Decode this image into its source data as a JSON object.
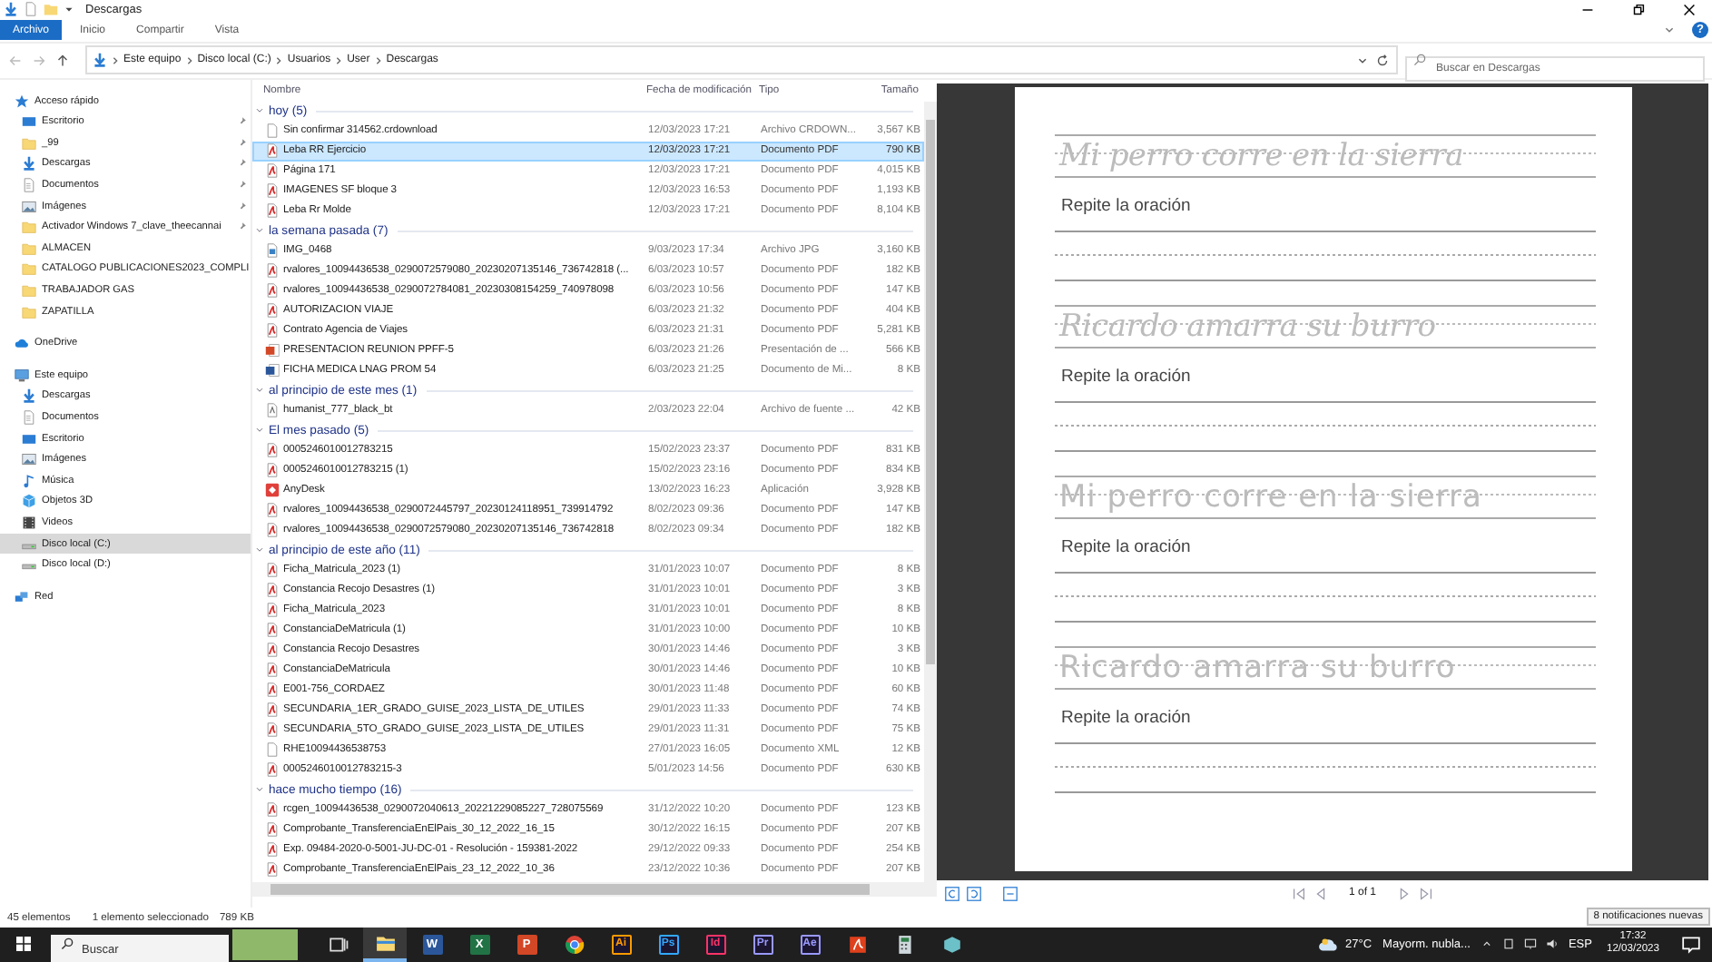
{
  "window": {
    "title": "Descargas",
    "help": "?"
  },
  "ribbon_tabs": [
    {
      "label": "Archivo",
      "selected": true
    },
    {
      "label": "Inicio",
      "selected": false
    },
    {
      "label": "Compartir",
      "selected": false
    },
    {
      "label": "Vista",
      "selected": false
    }
  ],
  "breadcrumb": [
    "Este equipo",
    "Disco local (C:)",
    "Usuarios",
    "User",
    "Descargas"
  ],
  "search": {
    "placeholder": "Buscar en Descargas"
  },
  "nav_pane": [
    {
      "label": "Acceso rápido",
      "kind": "star",
      "selected": false,
      "children": [
        {
          "label": "Escritorio",
          "kind": "desktop",
          "pinned": true,
          "selected": false
        },
        {
          "label": "_99",
          "kind": "folder",
          "pinned": true,
          "selected": false
        },
        {
          "label": "Descargas",
          "kind": "download",
          "pinned": true,
          "selected": false
        },
        {
          "label": "Documentos",
          "kind": "document",
          "pinned": true,
          "selected": false
        },
        {
          "label": "Imágenes",
          "kind": "pictures",
          "pinned": true,
          "selected": false
        },
        {
          "label": "Activador Windows 7_clave_theecannai",
          "kind": "folder",
          "pinned": true,
          "selected": false
        },
        {
          "label": "ALMACEN",
          "kind": "folder",
          "pinned": false,
          "selected": false
        },
        {
          "label": "CATALOGO PUBLICACIONES2023_COMPLI",
          "kind": "folder",
          "pinned": false,
          "selected": false
        },
        {
          "label": "TRABAJADOR GAS",
          "kind": "folder",
          "pinned": false,
          "selected": false
        },
        {
          "label": "ZAPATILLA",
          "kind": "folder",
          "pinned": false,
          "selected": false
        }
      ]
    },
    {
      "label": "OneDrive",
      "kind": "cloud",
      "selected": false
    },
    {
      "label": "Este equipo",
      "kind": "computer",
      "selected": false,
      "children": [
        {
          "label": "Descargas",
          "kind": "download",
          "selected": false
        },
        {
          "label": "Documentos",
          "kind": "document",
          "selected": false
        },
        {
          "label": "Escritorio",
          "kind": "desktop",
          "selected": false
        },
        {
          "label": "Imágenes",
          "kind": "pictures",
          "selected": false
        },
        {
          "label": "Música",
          "kind": "music",
          "selected": false
        },
        {
          "label": "Objetos 3D",
          "kind": "cube",
          "selected": false
        },
        {
          "label": "Videos",
          "kind": "video",
          "selected": false
        },
        {
          "label": "Disco local (C:)",
          "kind": "drive",
          "selected": true
        },
        {
          "label": "Disco local (D:)",
          "kind": "drive",
          "selected": false
        }
      ]
    },
    {
      "label": "Red",
      "kind": "network",
      "selected": false
    }
  ],
  "file_list": {
    "columns": [
      "Nombre",
      "Fecha de modificación",
      "Tipo",
      "Tamaño"
    ],
    "groups": [
      {
        "title": "hoy (5)",
        "files": [
          {
            "name": "Sin confirmar 314562.crdownload",
            "date": "12/03/2023 17:21",
            "type": "Archivo CRDOWN...",
            "size": "3,567 KB",
            "kind": "blank",
            "selected": false
          },
          {
            "name": "Leba RR Ejercicio",
            "date": "12/03/2023 17:21",
            "type": "Documento PDF",
            "size": "790 KB",
            "kind": "pdf",
            "selected": true
          },
          {
            "name": "Página 171",
            "date": "12/03/2023 17:21",
            "type": "Documento PDF",
            "size": "4,015 KB",
            "kind": "pdf",
            "selected": false
          },
          {
            "name": "IMAGENES SF bloque 3",
            "date": "12/03/2023 16:53",
            "type": "Documento PDF",
            "size": "1,193 KB",
            "kind": "pdf",
            "selected": false
          },
          {
            "name": "Leba Rr Molde",
            "date": "12/03/2023 17:21",
            "type": "Documento PDF",
            "size": "8,104 KB",
            "kind": "pdf",
            "selected": false
          }
        ]
      },
      {
        "title": "la semana pasada (7)",
        "files": [
          {
            "name": "IMG_0468",
            "date": "9/03/2023 17:34",
            "type": "Archivo JPG",
            "size": "3,160 KB",
            "kind": "image",
            "selected": false
          },
          {
            "name": "rvalores_10094436538_0290072579080_20230207135146_736742818 (...",
            "date": "6/03/2023 10:57",
            "type": "Documento PDF",
            "size": "182 KB",
            "kind": "pdf",
            "selected": false
          },
          {
            "name": "rvalores_10094436538_0290072784081_20230308154259_740978098",
            "date": "6/03/2023 10:56",
            "type": "Documento PDF",
            "size": "147 KB",
            "kind": "pdf",
            "selected": false
          },
          {
            "name": "AUTORIZACION VIAJE",
            "date": "6/03/2023 21:32",
            "type": "Documento PDF",
            "size": "404 KB",
            "kind": "pdf",
            "selected": false
          },
          {
            "name": "Contrato Agencia de Viajes",
            "date": "6/03/2023 21:31",
            "type": "Documento PDF",
            "size": "5,281 KB",
            "kind": "pdf",
            "selected": false
          },
          {
            "name": "PRESENTACION REUNION PPFF-5",
            "date": "6/03/2023 21:26",
            "type": "Presentación de ...",
            "size": "566 KB",
            "kind": "slides",
            "selected": false
          },
          {
            "name": "FICHA MEDICA LNAG PROM 54",
            "date": "6/03/2023 21:25",
            "type": "Documento de Mi...",
            "size": "8 KB",
            "kind": "word",
            "selected": false
          }
        ]
      },
      {
        "title": "al principio de este mes (1)",
        "files": [
          {
            "name": "humanist_777_black_bt",
            "date": "2/03/2023 22:04",
            "type": "Archivo de fuente ...",
            "size": "42 KB",
            "kind": "font",
            "selected": false
          }
        ]
      },
      {
        "title": "El mes pasado (5)",
        "files": [
          {
            "name": "0005246010012783215",
            "date": "15/02/2023 23:37",
            "type": "Documento PDF",
            "size": "831 KB",
            "kind": "pdf",
            "selected": false
          },
          {
            "name": "0005246010012783215 (1)",
            "date": "15/02/2023 23:16",
            "type": "Documento PDF",
            "size": "834 KB",
            "kind": "pdf",
            "selected": false
          },
          {
            "name": "AnyDesk",
            "date": "13/02/2023 16:23",
            "type": "Aplicación",
            "size": "3,928 KB",
            "kind": "app",
            "selected": false
          },
          {
            "name": "rvalores_10094436538_0290072445797_20230124118951_739914792",
            "date": "8/02/2023 09:36",
            "type": "Documento PDF",
            "size": "147 KB",
            "kind": "pdf",
            "selected": false
          },
          {
            "name": "rvalores_10094436538_0290072579080_20230207135146_736742818",
            "date": "8/02/2023 09:34",
            "type": "Documento PDF",
            "size": "182 KB",
            "kind": "pdf",
            "selected": false
          }
        ]
      },
      {
        "title": "al principio de este año (11)",
        "files": [
          {
            "name": "Ficha_Matricula_2023 (1)",
            "date": "31/01/2023 10:07",
            "type": "Documento PDF",
            "size": "8 KB",
            "kind": "pdf",
            "selected": false
          },
          {
            "name": "Constancia Recojo Desastres (1)",
            "date": "31/01/2023 10:01",
            "type": "Documento PDF",
            "size": "3 KB",
            "kind": "pdf",
            "selected": false
          },
          {
            "name": "Ficha_Matricula_2023",
            "date": "31/01/2023 10:01",
            "type": "Documento PDF",
            "size": "8 KB",
            "kind": "pdf",
            "selected": false
          },
          {
            "name": "ConstanciaDeMatricula (1)",
            "date": "31/01/2023 10:00",
            "type": "Documento PDF",
            "size": "10 KB",
            "kind": "pdf",
            "selected": false
          },
          {
            "name": "Constancia Recojo Desastres",
            "date": "30/01/2023 14:46",
            "type": "Documento PDF",
            "size": "3 KB",
            "kind": "pdf",
            "selected": false
          },
          {
            "name": "ConstanciaDeMatricula",
            "date": "30/01/2023 14:46",
            "type": "Documento PDF",
            "size": "10 KB",
            "kind": "pdf",
            "selected": false
          },
          {
            "name": "E001-756_CORDAEZ",
            "date": "30/01/2023 11:48",
            "type": "Documento PDF",
            "size": "60 KB",
            "kind": "pdf",
            "selected": false
          },
          {
            "name": "SECUNDARIA_1ER_GRADO_GUISE_2023_LISTA_DE_UTILES",
            "date": "29/01/2023 11:33",
            "type": "Documento PDF",
            "size": "74 KB",
            "kind": "pdf",
            "selected": false
          },
          {
            "name": "SECUNDARIA_5TO_GRADO_GUISE_2023_LISTA_DE_UTILES",
            "date": "29/01/2023 11:31",
            "type": "Documento PDF",
            "size": "75 KB",
            "kind": "pdf",
            "selected": false
          },
          {
            "name": "RHE10094436538753",
            "date": "27/01/2023 16:05",
            "type": "Documento XML",
            "size": "12 KB",
            "kind": "blank",
            "selected": false
          },
          {
            "name": "0005246010012783215-3",
            "date": "5/01/2023 14:56",
            "type": "Documento PDF",
            "size": "630 KB",
            "kind": "pdf",
            "selected": false
          }
        ]
      },
      {
        "title": "hace mucho tiempo (16)",
        "files": [
          {
            "name": "rcgen_10094436538_0290072040613_20221229085227_728075569",
            "date": "31/12/2022 10:20",
            "type": "Documento PDF",
            "size": "123 KB",
            "kind": "pdf",
            "selected": false
          },
          {
            "name": "Comprobante_TransferenciaEnElPais_30_12_2022_16_15",
            "date": "30/12/2022 16:15",
            "type": "Documento PDF",
            "size": "207 KB",
            "kind": "pdf",
            "selected": false
          },
          {
            "name": "Exp. 09484-2020-0-5001-JU-DC-01 - Resolución - 159381-2022",
            "date": "29/12/2022 09:33",
            "type": "Documento PDF",
            "size": "254 KB",
            "kind": "pdf",
            "selected": false
          },
          {
            "name": "Comprobante_TransferenciaEnElPais_23_12_2022_10_36",
            "date": "23/12/2022 10:36",
            "type": "Documento PDF",
            "size": "207 KB",
            "kind": "pdf",
            "selected": false
          }
        ]
      }
    ]
  },
  "preview": {
    "sections": [
      {
        "kind": "cursive",
        "trace": "Mi perro corre en la sierra",
        "prompt": "Repite la oración"
      },
      {
        "kind": "cursive",
        "trace": "Ricardo amarra su burro",
        "prompt": "Repite la oración"
      },
      {
        "kind": "print",
        "trace": "Mi perro corre en la sierra",
        "prompt": "Repite la oración"
      },
      {
        "kind": "print",
        "trace": "Ricardo amarra su burro",
        "prompt": "Repite la oración"
      }
    ],
    "page_indicator": "1 of 1"
  },
  "status_bar": {
    "count": "45 elementos",
    "selection": "1 elemento seleccionado",
    "size": "789 KB"
  },
  "notification_toast": "8 notificaciones nuevas",
  "taskbar": {
    "search": {
      "placeholder": "Buscar"
    },
    "apps": [
      {
        "kind": "task-view",
        "selected": false
      },
      {
        "kind": "folder",
        "selected": true
      },
      {
        "kind": "tile",
        "label": "W",
        "color": "#2b579a",
        "selected": false
      },
      {
        "kind": "tile",
        "label": "X",
        "color": "#217346",
        "selected": false
      },
      {
        "kind": "tile",
        "label": "P",
        "color": "#d24726",
        "selected": false
      },
      {
        "kind": "chrome",
        "selected": false
      },
      {
        "kind": "adobe",
        "label": "Ai",
        "color": "#ff9a00",
        "selected": false
      },
      {
        "kind": "adobe",
        "label": "Ps",
        "color": "#31a8ff",
        "selected": false
      },
      {
        "kind": "adobe",
        "label": "Id",
        "color": "#ff3366",
        "selected": false
      },
      {
        "kind": "adobe",
        "label": "Pr",
        "color": "#9999ff",
        "selected": false
      },
      {
        "kind": "adobe",
        "label": "Ae",
        "color": "#9999ff",
        "selected": false
      },
      {
        "kind": "acrobat",
        "selected": false
      },
      {
        "kind": "calculator",
        "selected": false
      },
      {
        "kind": "generic",
        "selected": false
      }
    ],
    "weather": {
      "temp": "27°C",
      "summary": "Mayorm. nubla..."
    },
    "language": "ESP",
    "time": "17:32",
    "date": "12/03/2023"
  }
}
